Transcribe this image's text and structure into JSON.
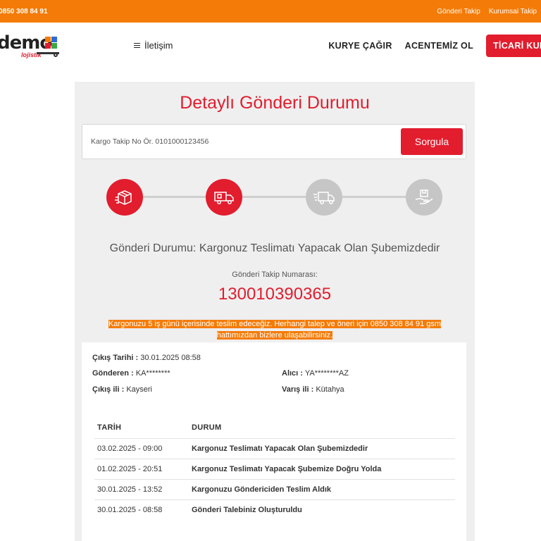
{
  "topbar": {
    "phone": "0850 308 84 91",
    "links": [
      "Gönderi Takip",
      "Kurumsal Takip"
    ]
  },
  "brand": {
    "logo_word": "demo",
    "logo_sub": "lojistik",
    "colors": {
      "primary": "#e11d2e",
      "accent": "#f47b07",
      "logo_blue": "#2b6cd6",
      "logo_green": "#3aa845"
    }
  },
  "nav": {
    "menu_label": "İletişim",
    "links": [
      "KURYE ÇAĞIR",
      "ACENTEMİZ OL"
    ],
    "cta_label": "TİCARİ KURYE"
  },
  "page": {
    "title": "Detaylı Gönderi Durumu",
    "search": {
      "placeholder": "Kargo Takip No Ör. 0101000123456",
      "button_label": "Sorgula"
    },
    "steps": [
      {
        "icon": "package-box-icon",
        "active": true
      },
      {
        "icon": "delivery-truck-icon",
        "active": true
      },
      {
        "icon": "fast-truck-icon",
        "active": false
      },
      {
        "icon": "hand-package-icon",
        "active": false
      }
    ],
    "status_text": "Gönderi Durumu: Kargonuz Teslimatı Yapacak Olan Şubemizdedir",
    "tracking_label": "Gönderi Takip Numarası:",
    "tracking_number": "130010390365",
    "notice": "Kargonuzu 5 iş günü içerisinde teslim edeceğiz. Herhangi talep ve öneri için 0850 308 84 91 gsm hattımızdan bizlere ulaşabilirsiniz."
  },
  "details": {
    "cikis_tarihi_label": "Çıkış Tarihi :",
    "cikis_tarihi": "30.01.2025 08:58",
    "gonderen_label": "Gönderen :",
    "gonderen": "KA********",
    "alici_label": "Alıcı :",
    "alici": "YA********AZ",
    "cikis_ili_label": "Çıkış ili :",
    "cikis_ili": "Kayseri",
    "varis_ili_label": "Varış ili :",
    "varis_ili": "Kütahya"
  },
  "history": {
    "headers": [
      "TARİH",
      "DURUM"
    ],
    "rows": [
      [
        "03.02.2025 - 09:00",
        "Kargonuz Teslimatı Yapacak Olan Şubemizdedir"
      ],
      [
        "01.02.2025 - 20:51",
        "Kargonuz Teslimatı Yapacak Şubemize Doğru Yolda"
      ],
      [
        "30.01.2025 - 13:52",
        "Kargonuzu Göndericiden Teslim Aldık"
      ],
      [
        "30.01.2025 - 08:58",
        "Gönderi Talebiniz Oluşturuldu"
      ]
    ]
  }
}
